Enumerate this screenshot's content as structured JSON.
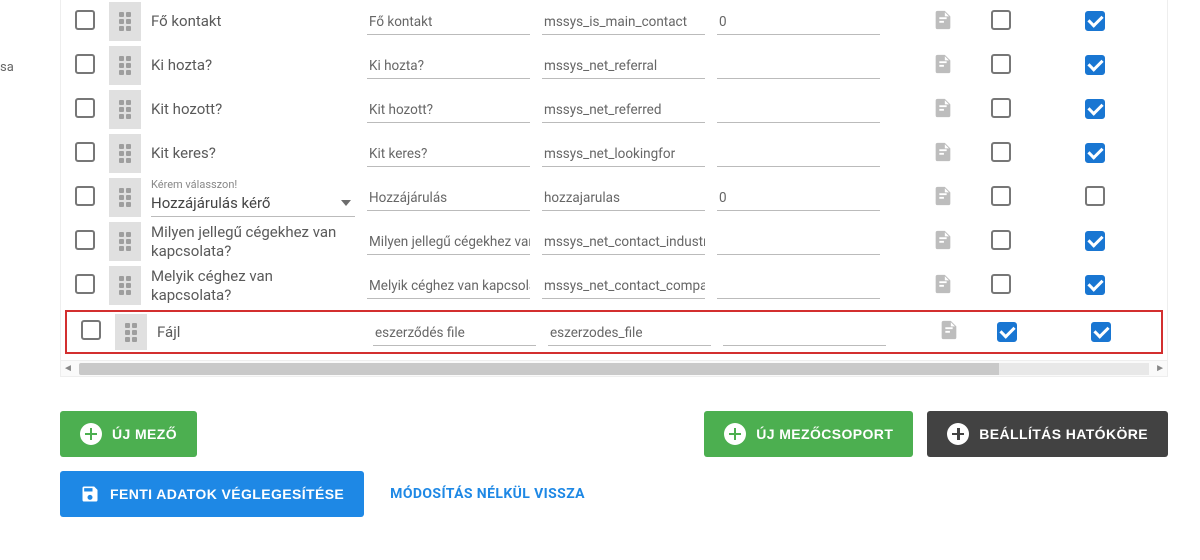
{
  "sidebar": {
    "fragment": "sa"
  },
  "rows": [
    {
      "name": "Fő kontakt",
      "label": "Fő kontakt",
      "tech": "mssys_is_main_contact",
      "def": "0",
      "cb2": false,
      "cb3": true,
      "dropdown": false
    },
    {
      "name": "Ki hozta?",
      "label": "Ki hozta?",
      "tech": "mssys_net_referral",
      "def": "",
      "cb2": false,
      "cb3": true,
      "dropdown": false
    },
    {
      "name": "Kit hozott?",
      "label": "Kit hozott?",
      "tech": "mssys_net_referred",
      "def": "",
      "cb2": false,
      "cb3": true,
      "dropdown": false
    },
    {
      "name": "Kit keres?",
      "label": "Kit keres?",
      "tech": "mssys_net_lookingfor",
      "def": "",
      "cb2": false,
      "cb3": true,
      "dropdown": false
    },
    {
      "name": "Hozzájárulás kérő",
      "helper": "Kérem válasszon!",
      "label": "Hozzájárulás",
      "tech": "hozzajarulas",
      "def": "0",
      "cb2": false,
      "cb3": false,
      "dropdown": true
    },
    {
      "name": "Milyen jellegű cégekhez van kapcsolata?",
      "label": "Milyen jellegű cégekhez van",
      "tech": "mssys_net_contact_industry",
      "def": "",
      "cb2": false,
      "cb3": true,
      "dropdown": false
    },
    {
      "name": "Melyik céghez van kapcsolata?",
      "label": "Melyik céghez van kapcsolat",
      "tech": "mssys_net_contact_compan",
      "def": "",
      "cb2": false,
      "cb3": true,
      "dropdown": false
    },
    {
      "name": "Fájl",
      "label": "eszerződés file",
      "tech": "eszerzodes_file",
      "def": "",
      "cb2": true,
      "cb3": true,
      "dropdown": false,
      "highlight": true
    }
  ],
  "buttons": {
    "new_field": "ÚJ MEZŐ",
    "new_group": "ÚJ MEZŐCSOPORT",
    "scope": "BEÁLLÍTÁS HATÓKÖRE",
    "save": "FENTI ADATOK VÉGLEGESÍTÉSE",
    "cancel": "MÓDOSÍTÁS NÉLKÜL VISSZA"
  }
}
